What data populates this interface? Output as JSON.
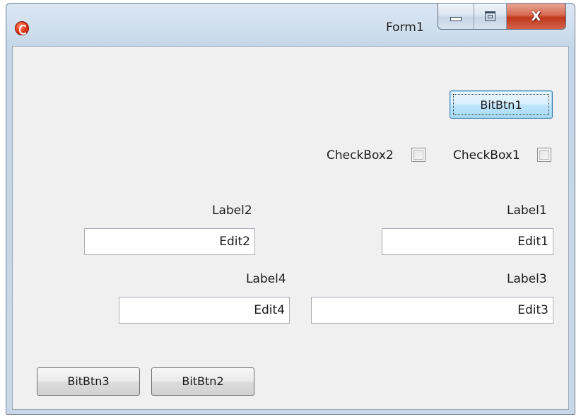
{
  "window": {
    "title": "Form1",
    "close_glyph": "X",
    "icons": {
      "app": "app-icon",
      "minimize": "minimize-icon",
      "maximize": "maximize-icon",
      "close": "close-icon"
    }
  },
  "buttons": {
    "bitbtn1": "BitBtn1",
    "bitbtn2": "BitBtn2",
    "bitbtn3": "BitBtn3"
  },
  "checkboxes": {
    "checkbox1": {
      "label": "CheckBox1",
      "checked": false
    },
    "checkbox2": {
      "label": "CheckBox2",
      "checked": false
    }
  },
  "labels": {
    "label1": "Label1",
    "label2": "Label2",
    "label3": "Label3",
    "label4": "Label4"
  },
  "edits": {
    "edit1": "Edit1",
    "edit2": "Edit2",
    "edit3": "Edit3",
    "edit4": "Edit4"
  }
}
